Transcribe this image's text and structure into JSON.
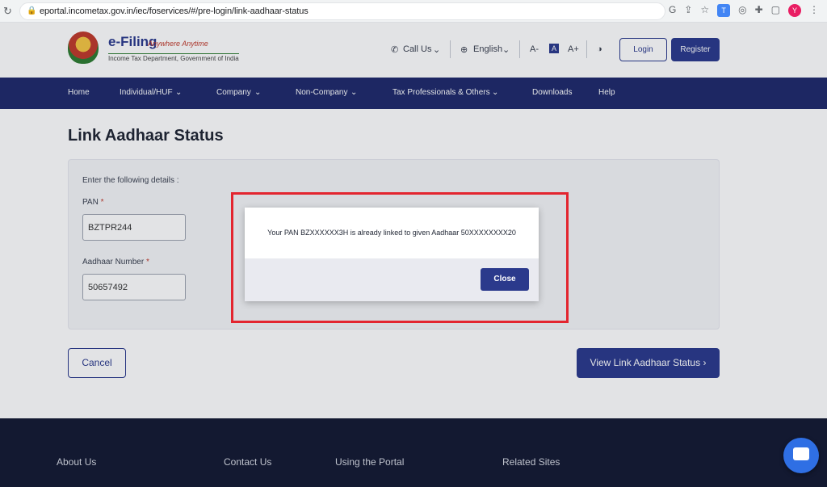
{
  "browser": {
    "url": "eportal.incometax.gov.in/iec/foservices/#/pre-login/link-aadhaar-status",
    "icons": [
      "reload-icon",
      "lock-icon",
      "google-icon",
      "share-icon",
      "star-icon",
      "translate-icon",
      "extension-icon",
      "puzzle-icon",
      "sidepanel-icon",
      "profile-avatar",
      "kebab-menu-icon"
    ],
    "profile_initial": "Y"
  },
  "header": {
    "logo_title": "e-Filing",
    "logo_tagline": "Anywhere Anytime",
    "logo_subtitle": "Income Tax Department, Government of India",
    "call_us": "Call Us",
    "language": "English",
    "font_decrease": "A-",
    "font_normal": "A",
    "font_increase": "A+",
    "contrast_icon": "contrast-icon",
    "login": "Login",
    "register": "Register"
  },
  "nav": {
    "items": [
      {
        "label": "Home"
      },
      {
        "label": "Individual/HUF"
      },
      {
        "label": "Company"
      },
      {
        "label": "Non-Company"
      },
      {
        "label": "Tax Professionals & Others"
      },
      {
        "label": "Downloads"
      },
      {
        "label": "Help"
      }
    ]
  },
  "main": {
    "title": "Link Aadhaar Status",
    "instructions": "Enter the following details :",
    "pan_label": "PAN",
    "pan_value": "BZTPR244",
    "aadhaar_label": "Aadhaar Number",
    "aadhaar_value": "50657492",
    "required_mark": "*",
    "cancel": "Cancel",
    "view_status": "View Link Aadhaar Status"
  },
  "modal": {
    "message": "Your PAN BZXXXXXX3H is already linked to given Aadhaar 50XXXXXXXX20",
    "close": "Close"
  },
  "footer": {
    "columns": [
      "About Us",
      "Contact Us",
      "Using the Portal",
      "Related Sites"
    ]
  },
  "colors": {
    "brand_navy": "#1f2a6b",
    "button_blue": "#2b3a8c",
    "highlight_red": "#e3252f",
    "footer_bg": "#141a33"
  }
}
